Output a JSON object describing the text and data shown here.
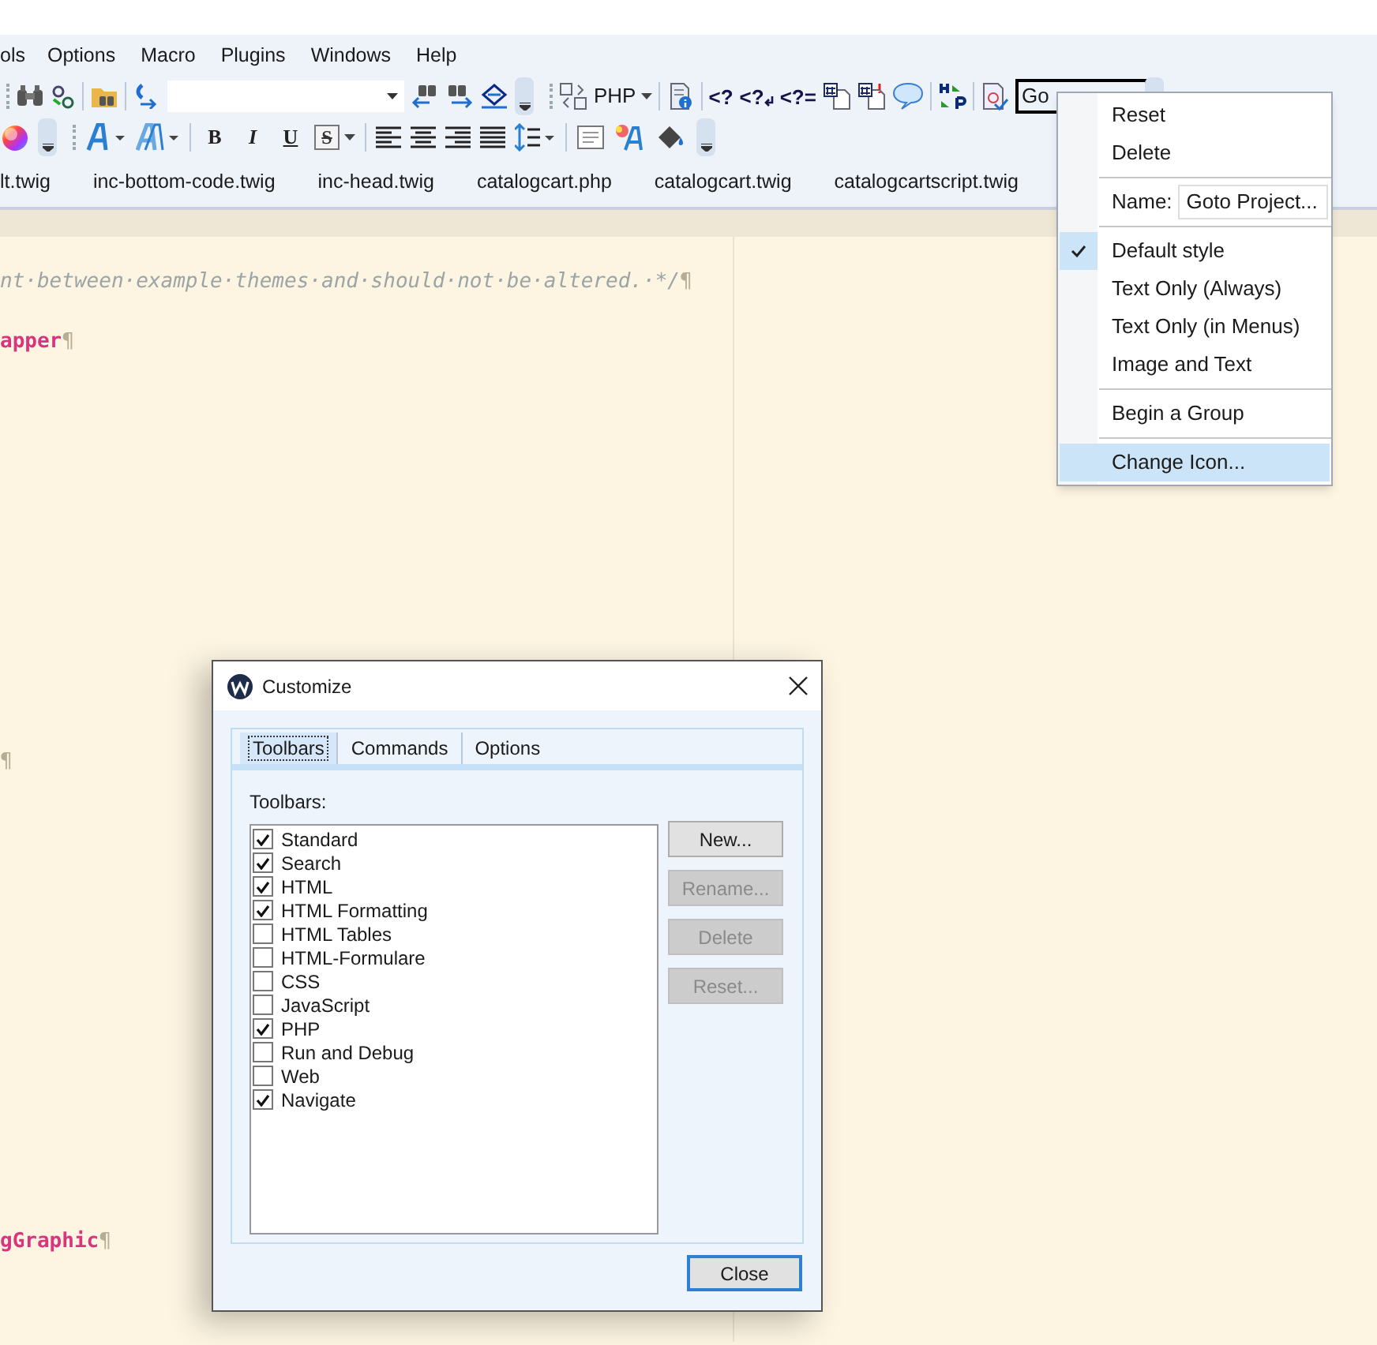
{
  "menu_bar": [
    {
      "label": "ols"
    },
    {
      "label": "Options"
    },
    {
      "label": "Macro"
    },
    {
      "label": "Plugins"
    },
    {
      "label": "Windows"
    },
    {
      "label": "Help"
    }
  ],
  "toolbar": {
    "php_menu": "PHP",
    "php_tags": [
      "<?",
      "<?",
      "<?="
    ],
    "goto_field": "Go",
    "format_buttons": [
      "B",
      "I",
      "U",
      "S"
    ]
  },
  "file_tabs": [
    {
      "label": "lt.twig"
    },
    {
      "label": "inc-bottom-code.twig"
    },
    {
      "label": "inc-head.twig"
    },
    {
      "label": "catalogcart.php"
    },
    {
      "label": "catalogcart.twig"
    },
    {
      "label": "catalogcartscript.twig"
    }
  ],
  "editor": {
    "lines": [
      {
        "kind": "blank"
      },
      {
        "kind": "comment",
        "text": "nt·between·example·themes·and·should·not·be·altered.·*/",
        "eol": "¶"
      },
      {
        "kind": "blank"
      },
      {
        "kind": "keyword",
        "text": "apper",
        "eol": "¶"
      },
      {
        "kind": "blank"
      },
      {
        "kind": "blank"
      },
      {
        "kind": "blank"
      },
      {
        "kind": "blank"
      },
      {
        "kind": "blank"
      },
      {
        "kind": "blank"
      },
      {
        "kind": "blank"
      },
      {
        "kind": "blank"
      },
      {
        "kind": "blank"
      },
      {
        "kind": "blank"
      },
      {
        "kind": "blank"
      },
      {
        "kind": "blank"
      },
      {
        "kind": "blank"
      },
      {
        "kind": "mark",
        "eol": "¶"
      },
      {
        "kind": "blank"
      },
      {
        "kind": "blank"
      },
      {
        "kind": "blank"
      },
      {
        "kind": "blank"
      },
      {
        "kind": "blank"
      },
      {
        "kind": "blank"
      },
      {
        "kind": "blank"
      },
      {
        "kind": "blank"
      },
      {
        "kind": "blank"
      },
      {
        "kind": "blank"
      },
      {
        "kind": "blank"
      },
      {
        "kind": "blank"
      },
      {
        "kind": "blank"
      },
      {
        "kind": "blank"
      },
      {
        "kind": "blank"
      },
      {
        "kind": "keyword",
        "text": "gGraphic",
        "eol": "¶"
      }
    ]
  },
  "context_menu": {
    "items": [
      {
        "kind": "command",
        "label": "Reset",
        "highlighted": false
      },
      {
        "kind": "command",
        "label": "Delete",
        "highlighted": false
      },
      {
        "kind": "separator"
      },
      {
        "kind": "name",
        "label": "Name:",
        "value": "Goto Project...",
        "highlighted": false
      },
      {
        "kind": "separator"
      },
      {
        "kind": "option",
        "label": "Default style",
        "checked": true,
        "highlighted": false
      },
      {
        "kind": "option",
        "label": "Text Only (Always)",
        "checked": false,
        "highlighted": false
      },
      {
        "kind": "option",
        "label": "Text Only (in Menus)",
        "checked": false,
        "highlighted": false
      },
      {
        "kind": "option",
        "label": "Image and Text",
        "checked": false,
        "highlighted": false
      },
      {
        "kind": "separator"
      },
      {
        "kind": "command",
        "label": "Begin a Group",
        "highlighted": false
      },
      {
        "kind": "separator"
      },
      {
        "kind": "command",
        "label": "Change Icon...",
        "highlighted": true
      }
    ]
  },
  "dialog": {
    "title": "Customize",
    "tabs": [
      {
        "label": "Toolbars",
        "selected": true
      },
      {
        "label": "Commands",
        "selected": false
      },
      {
        "label": "Options",
        "selected": false
      }
    ],
    "list_label": "Toolbars:",
    "toolbars": [
      {
        "label": "Standard",
        "checked": true
      },
      {
        "label": "Search",
        "checked": true
      },
      {
        "label": "HTML",
        "checked": true
      },
      {
        "label": "HTML Formatting",
        "checked": true
      },
      {
        "label": "HTML Tables",
        "checked": false
      },
      {
        "label": "HTML-Formulare",
        "checked": false
      },
      {
        "label": "CSS",
        "checked": false
      },
      {
        "label": "JavaScript",
        "checked": false
      },
      {
        "label": "PHP",
        "checked": true
      },
      {
        "label": "Run and Debug",
        "checked": false
      },
      {
        "label": "Web",
        "checked": false
      },
      {
        "label": "Navigate",
        "checked": true
      }
    ],
    "buttons": [
      {
        "label": "New...",
        "disabled": false
      },
      {
        "label": "Rename...",
        "disabled": true
      },
      {
        "label": "Delete",
        "disabled": true
      },
      {
        "label": "Reset...",
        "disabled": true
      }
    ],
    "close_button": "Close"
  }
}
